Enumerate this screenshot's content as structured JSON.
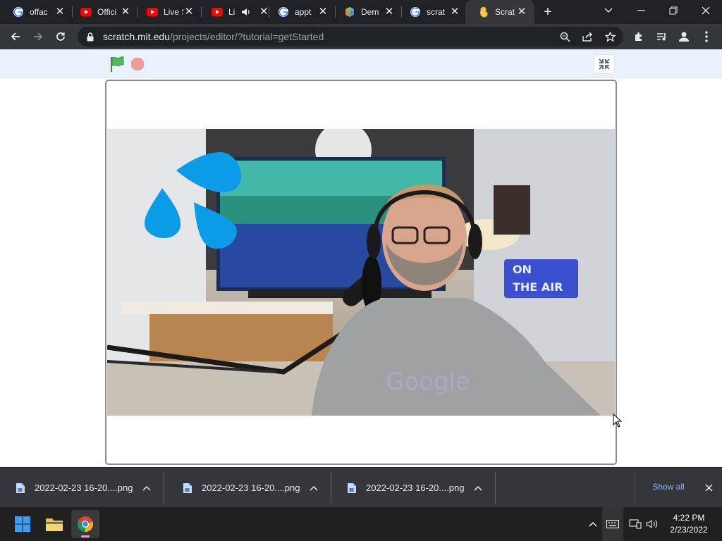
{
  "browser": {
    "tabs": [
      {
        "title": "offac",
        "favicon": "google-icon",
        "active": false
      },
      {
        "title": "Offici",
        "favicon": "youtube-icon",
        "active": false
      },
      {
        "title": "Live S",
        "favicon": "youtube-icon",
        "active": false
      },
      {
        "title": "Li",
        "favicon": "youtube-icon",
        "audio": true,
        "active": false
      },
      {
        "title": "appt",
        "favicon": "google-icon",
        "active": false
      },
      {
        "title": "Dem",
        "favicon": "cube-icon",
        "active": false
      },
      {
        "title": "scrat",
        "favicon": "google-icon",
        "active": false
      },
      {
        "title": "Scrat",
        "favicon": "scratch-icon",
        "active": true
      }
    ],
    "url_host": "scratch.mit.edu",
    "url_path": "/projects/editor/?tutorial=getStarted"
  },
  "downloads": {
    "items": [
      {
        "name": "2022-02-23 16-20....png"
      },
      {
        "name": "2022-02-23 16-20....png"
      },
      {
        "name": "2022-02-23 16-20....png"
      }
    ],
    "show_all": "Show all"
  },
  "taskbar": {
    "time": "4:22 PM",
    "date": "2/23/2022"
  },
  "colors": {
    "scratch_green": "#4cbf56",
    "scratch_stop": "#ec9c9c",
    "sprite_blue": "#0b9ce8"
  }
}
